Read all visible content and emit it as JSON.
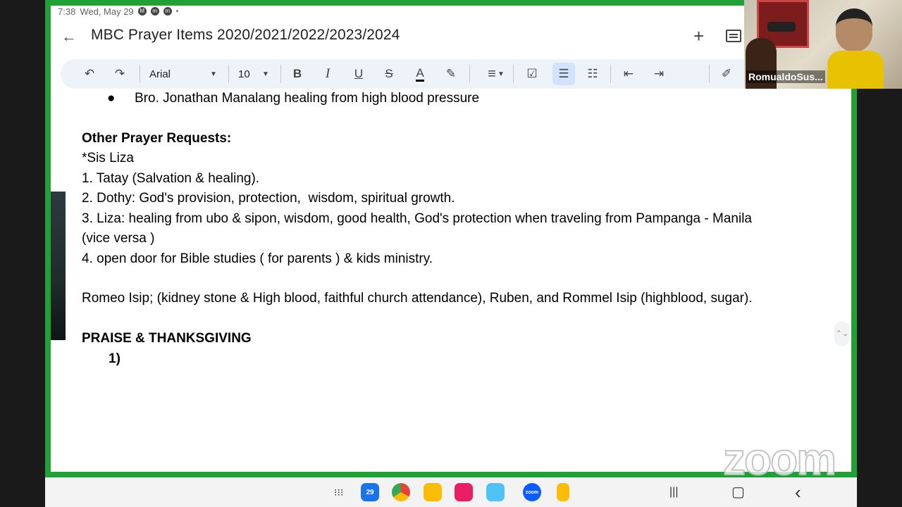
{
  "status_bar": {
    "time": "7:38",
    "date": "Wed, May 29",
    "dot": "•"
  },
  "header": {
    "title": "MBC Prayer Items 2020/2021/2022/2023/2024"
  },
  "toolbar": {
    "font": "Arial",
    "font_size": "10"
  },
  "icons": {
    "back": "←",
    "add": "+",
    "undo": "↶",
    "redo": "↷",
    "bold": "B",
    "italic": "I",
    "underline": "U",
    "strike": "S",
    "text_color": "A",
    "highlight": "✎",
    "align": "≡",
    "checklist": "☑",
    "bullets": "☰",
    "numbered": "☷",
    "outdent": "⇤",
    "indent": "⇥",
    "edit": "✐",
    "caret": "▼",
    "scroll": "⌃⌄",
    "nav_apps": "⁝⁝⁝",
    "nav_recent": "|||",
    "nav_home": "▢",
    "nav_back": "‹"
  },
  "document": {
    "bullet_item": "Bro. Jonathan Manalang healing from high blood pressure",
    "bullet_glyph": "●",
    "other_heading": "Other Prayer Requests:",
    "sis_liza": "*Sis Liza",
    "item1": "1. Tatay (Salvation & healing).",
    "item2": "2. Dothy: God's provision, protection,  wisdom, spiritual growth.",
    "item3a": "3. Liza: healing from ubo & sipon, wisdom, good health, God's protection when traveling from Pampanga - Manila",
    "item3b": "(vice versa )",
    "item4": "4. open door for Bible studies ( for parents ) & kids ministry.",
    "romeo": "Romeo Isip; (kidney stone & High blood, faithful church attendance), Ruben, and Rommel Isip (highblood, sugar).",
    "praise_heading": "PRAISE & THANKSGIVING",
    "praise_item": "1)"
  },
  "video": {
    "participant": "RomualdoSus..."
  },
  "watermark": "zoom",
  "nav": {
    "calendar_day": "29",
    "zoom_label": "zoom"
  },
  "colors": {
    "frame": "#21a038",
    "toolbar_bg": "#eef2f9",
    "active_bg": "#d3e3fd"
  }
}
